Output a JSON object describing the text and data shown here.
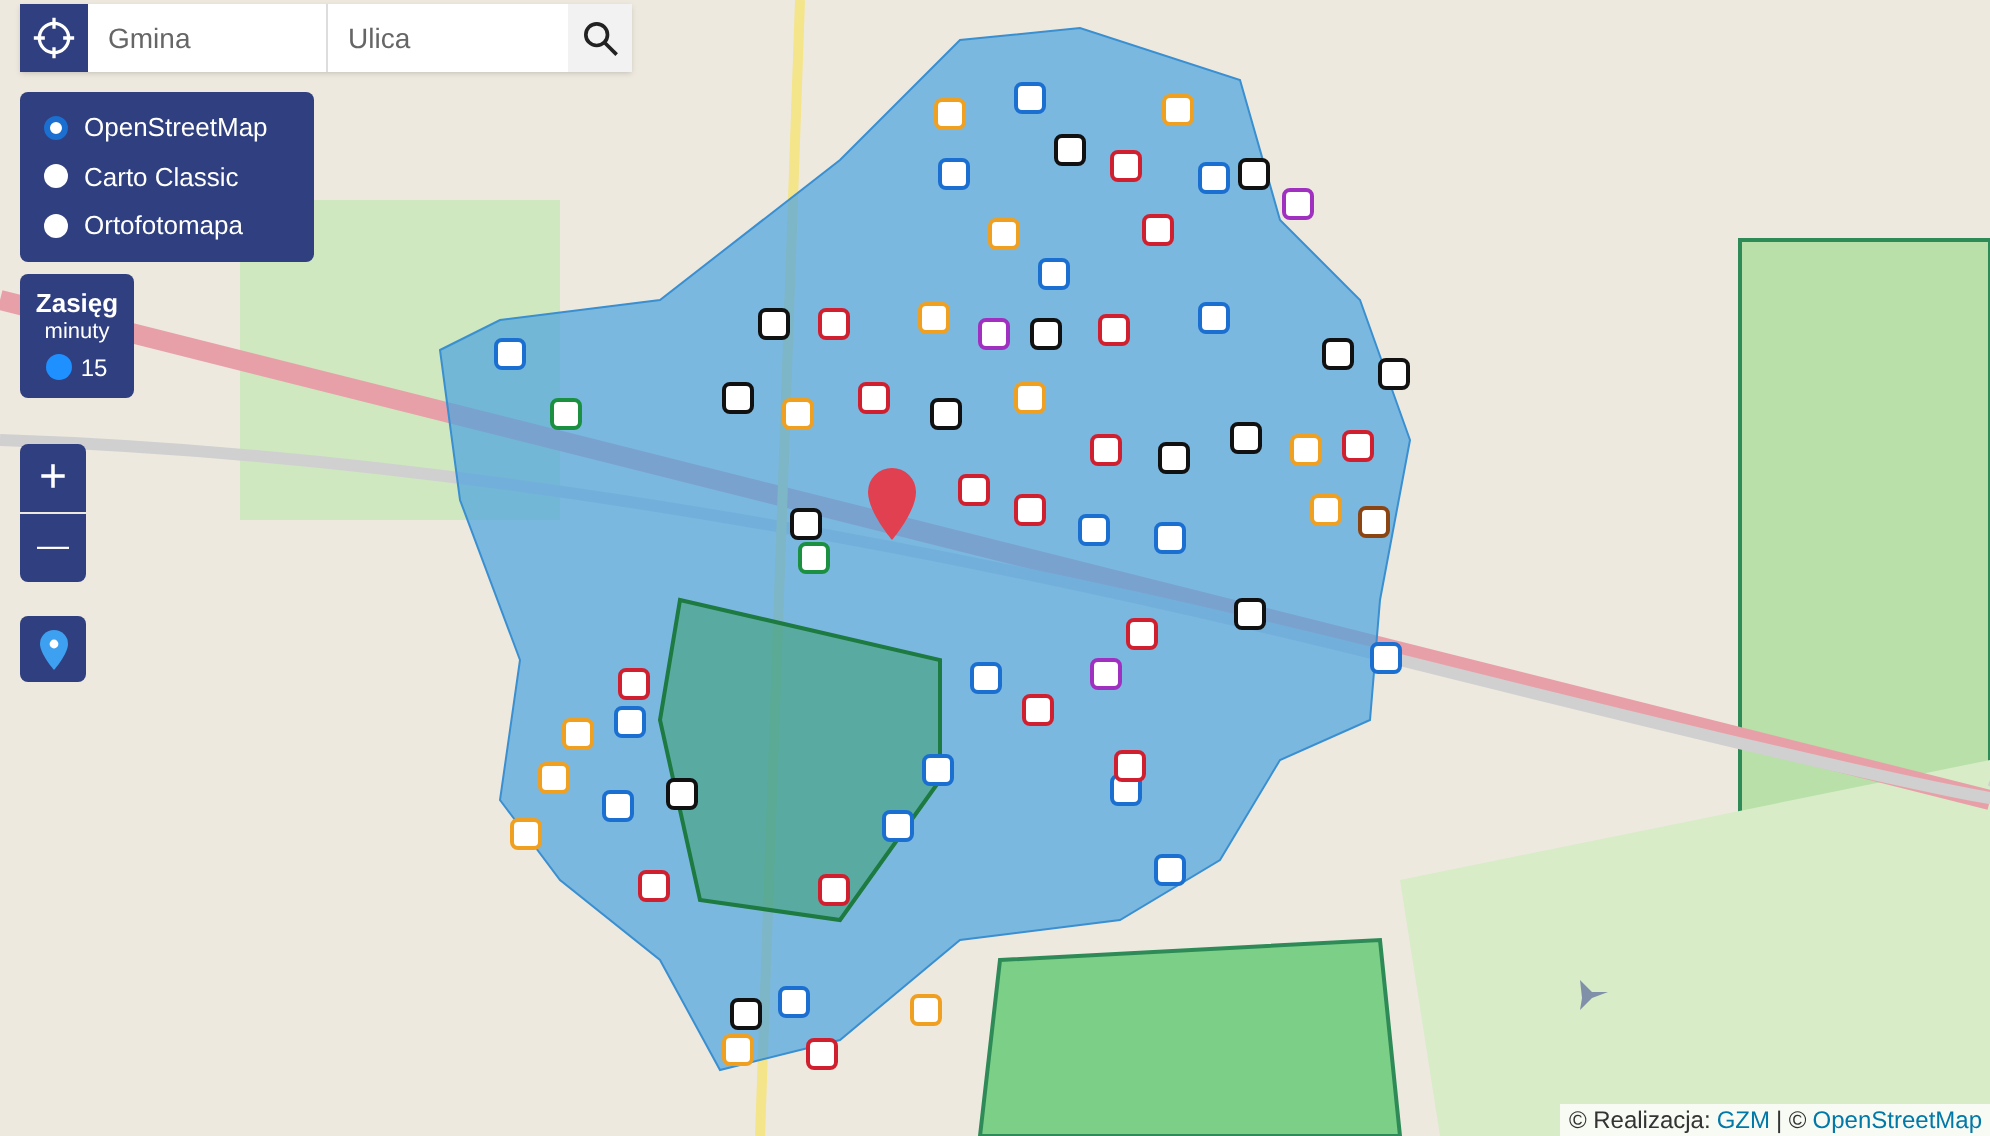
{
  "search": {
    "municipality_placeholder": "Gmina",
    "street_placeholder": "Ulica"
  },
  "layers": [
    {
      "label": "OpenStreetMap",
      "selected": true
    },
    {
      "label": "Carto Classic",
      "selected": false
    },
    {
      "label": "Ortofotomapa",
      "selected": false
    }
  ],
  "range": {
    "title": "Zasięg",
    "unit": "minuty",
    "value": "15"
  },
  "zoom": {
    "in": "+",
    "out": "—"
  },
  "attribution": [
    {
      "kind": "text",
      "text": "© Realizacja:"
    },
    {
      "kind": "link",
      "text": "GZM"
    },
    {
      "kind": "text",
      "text": "| ©"
    },
    {
      "kind": "link",
      "text": "OpenStreetMap"
    }
  ]
}
